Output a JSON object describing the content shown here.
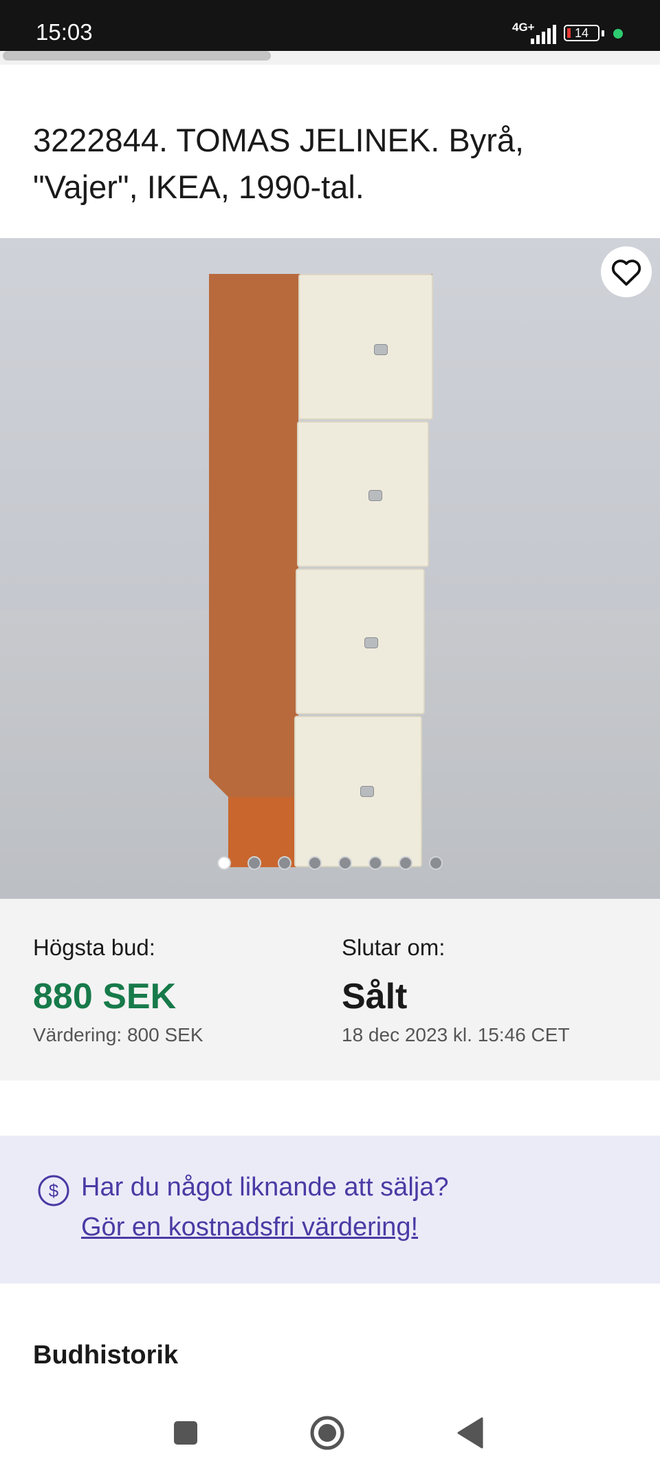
{
  "status_bar": {
    "time": "15:03",
    "network": "4G+",
    "battery": "14"
  },
  "listing": {
    "title": "3222844. TOMAS JELINEK. Byrå, \"Vajer\", IKEA, 1990-tal.",
    "image_count": 8,
    "active_image": 1
  },
  "bid": {
    "label": "Högsta bud:",
    "amount": "880 SEK",
    "estimate": "Värdering: 800 SEK"
  },
  "ending": {
    "label": "Slutar om:",
    "status": "Sålt",
    "date": "18 dec 2023 kl. 15:46 CET"
  },
  "promo": {
    "question": "Har du något liknande att sälja?",
    "link": "Gör en kostnadsfri värdering!"
  },
  "bid_history": {
    "title": "Budhistorik"
  },
  "colors": {
    "price_green": "#177a4a",
    "promo_purple": "#4b3aa4",
    "promo_bg": "#ebebf8"
  },
  "icons": [
    "heart-icon",
    "dollar-circle-icon",
    "square-icon",
    "home-circle-icon",
    "back-triangle-icon"
  ]
}
